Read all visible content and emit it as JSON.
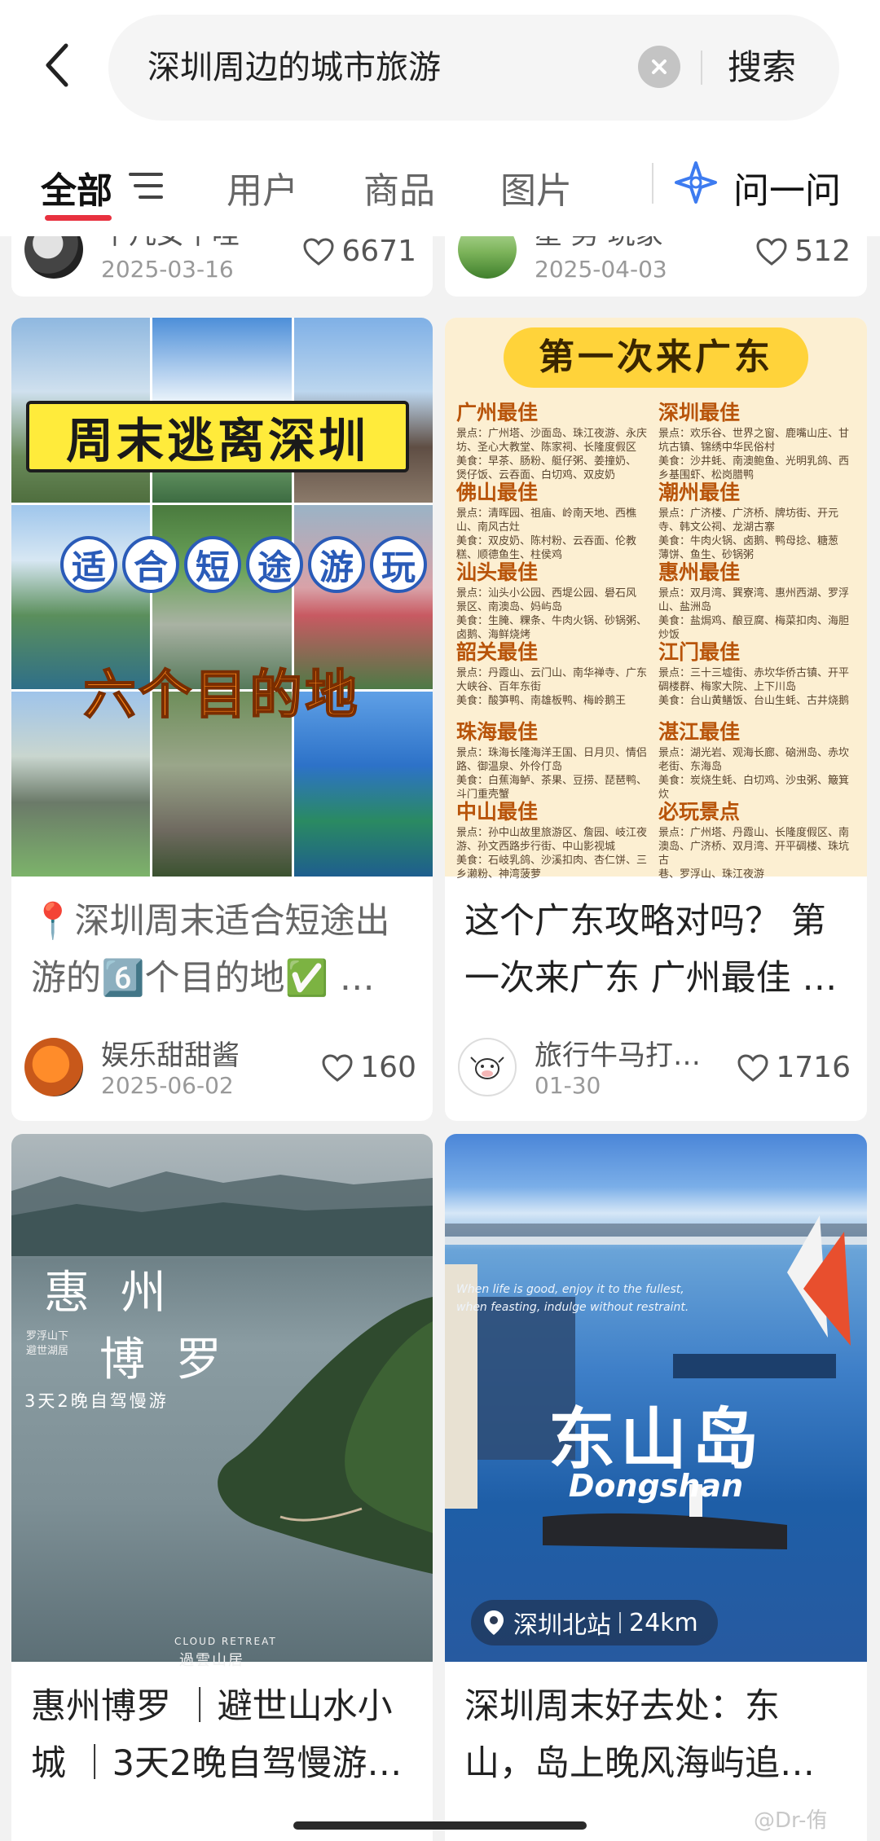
{
  "header": {
    "query": "深圳周边的城市旅游",
    "search_label": "搜索"
  },
  "tabs": {
    "all": "全部",
    "users": "用户",
    "goods": "商品",
    "images": "图片",
    "ask": "问一问"
  },
  "cards": [
    {
      "author": "平凡女平哇",
      "date": "2025-03-16",
      "likes": "6671"
    },
    {
      "author": "星·男·玩家",
      "date": "2025-04-03",
      "likes": "512"
    },
    {
      "image_text": {
        "banner": "周末逃离深圳",
        "circles": [
          "适",
          "合",
          "短",
          "途",
          "游",
          "玩"
        ],
        "bottom": "六个目的地"
      },
      "title": "📍深圳周末适合短途出游的6️⃣个目的地✅ …",
      "author": "娱乐甜甜酱",
      "date": "2025-06-02",
      "likes": "160"
    },
    {
      "image_text": {
        "title": "第一次来广东",
        "sections": [
          {
            "name": "广州最佳",
            "lines": [
              "景点：广州塔、沙面岛、珠江夜游、永庆",
              "坊、圣心大教堂、陈家祠、长隆度假区",
              "美食：早茶、肠粉、艇仔粥、姜撞奶、",
              "煲仔饭、云吞面、白切鸡、双皮奶"
            ]
          },
          {
            "name": "深圳最佳",
            "lines": [
              "景点：欢乐谷、世界之窗、鹿嘴山庄、甘",
              "坑古镇、锦绣中华民俗村",
              "美食：沙井蚝、南澳鲍鱼、光明乳鸽、西",
              "乡基围虾、松岗腊鸭"
            ]
          },
          {
            "name": "佛山最佳",
            "lines": [
              "景点：清晖园、祖庙、岭南天地、西樵",
              "山、南风古灶",
              "美食：双皮奶、陈村粉、云吞面、伦教",
              "糕、顺德鱼生、柱侯鸡"
            ]
          },
          {
            "name": "潮州最佳",
            "lines": [
              "景点：广济楼、广济桥、牌坊街、开元",
              "寺、韩文公祠、龙湖古寨",
              "美食：牛肉火锅、卤鹅、鸭母捻、糖葱",
              "薄饼、鱼生、砂锅粥"
            ]
          },
          {
            "name": "汕头最佳",
            "lines": [
              "景点：汕头小公园、西堤公园、礐石风",
              "景区、南澳岛、妈屿岛",
              "美食：生腌、粿条、牛肉火锅、砂锅粥、",
              "卤鹅、海鲜烧烤"
            ]
          },
          {
            "name": "惠州最佳",
            "lines": [
              "景点：双月湾、巽寮湾、惠州西湖、罗浮",
              "山、盐洲岛",
              "美食：盐焗鸡、酿豆腐、梅菜扣肉、海胆",
              "炒饭"
            ]
          },
          {
            "name": "韶关最佳",
            "lines": [
              "景点：丹霞山、云门山、南华禅寺、广东",
              "大峡谷、百年东街",
              "美食：酸笋鸭、南雄板鸭、梅岭鹅王"
            ]
          },
          {
            "name": "江门最佳",
            "lines": [
              "景点：三十三墟街、赤坎华侨古镇、开平",
              "碉楼群、梅家大院、上下川岛",
              "美食：台山黄鳝饭、台山生蚝、古井烧鹅"
            ]
          },
          {
            "name": "珠海最佳",
            "lines": [
              "景点：珠海长隆海洋王国、日月贝、情侣",
              "路、御温泉、外伶仃岛",
              "美食：白蕉海鲈、茶果、豆捞、琵琶鸭、",
              "斗门重壳蟹"
            ]
          },
          {
            "name": "湛江最佳",
            "lines": [
              "景点：湖光岩、观海长廊、硇洲岛、赤坎",
              "老街、东海岛",
              "美食：炭烧生蚝、白切鸡、沙虫粥、簸箕",
              "炊"
            ]
          },
          {
            "name": "中山最佳",
            "lines": [
              "景点：孙中山故里旅游区、詹园、岐江夜",
              "游、孙文西路步行街、中山影视城",
              "美食：石岐乳鸽、沙溪扣肉、杏仁饼、三",
              "乡濑粉、神湾菠萝"
            ]
          },
          {
            "name": "必玩景点",
            "lines": [
              "景点：广州塔、丹霞山、长隆度假区、南",
              "澳岛、广济桥、双月湾、开平碉楼、珠坑古",
              "巷、罗浮山、珠江夜游"
            ]
          }
        ]
      },
      "title": "这个广东攻略对吗？ 第一次来广东 广州最佳 …",
      "author": "旅行牛马打…",
      "date": "01-30",
      "likes": "1716"
    },
    {
      "image_text": {
        "title_top": "惠 州",
        "title_bottom": "博 罗",
        "side_1": "罗浮山下",
        "side_2": "避世湖居",
        "caption": "3天2晚自驾慢游",
        "brand_en": "CLOUD RETREAT",
        "brand_zh": "過雲山居"
      },
      "title": "惠州博罗 ｜避世山水小城 ｜3天2晚自驾慢游…"
    },
    {
      "image_text": {
        "quote_1": "When life is good, enjoy it to the fullest,",
        "quote_2": "when feasting, indulge without restraint.",
        "title_zh": "东山岛",
        "title_en": "Dongshan",
        "station": "深圳北站",
        "distance": "24km"
      },
      "title": "深圳周末好去处：东山，岛上晚风海屿追…"
    }
  ],
  "watermark": "@Dr-侑",
  "colors": {
    "accent": "#e8313f",
    "ask_icon": "#3d7bf0"
  }
}
